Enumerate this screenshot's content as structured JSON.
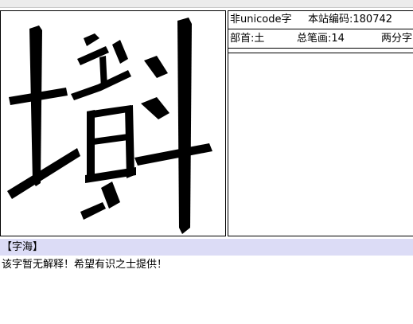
{
  "glyph": {
    "character": "𫰒",
    "icon": "character-glyph-image"
  },
  "meta": {
    "unicode_status": "非unicode字",
    "site_code": "本站编码:180742",
    "radical": "部首:土",
    "stroke_total": "总笔画:14",
    "split": "两分字"
  },
  "dictionary": {
    "section_title": "【字海】",
    "explanation": "该字暂无解释！希望有识之士提供！"
  },
  "colors": {
    "header_bg": "#dcdcf6",
    "border": "#000000"
  }
}
